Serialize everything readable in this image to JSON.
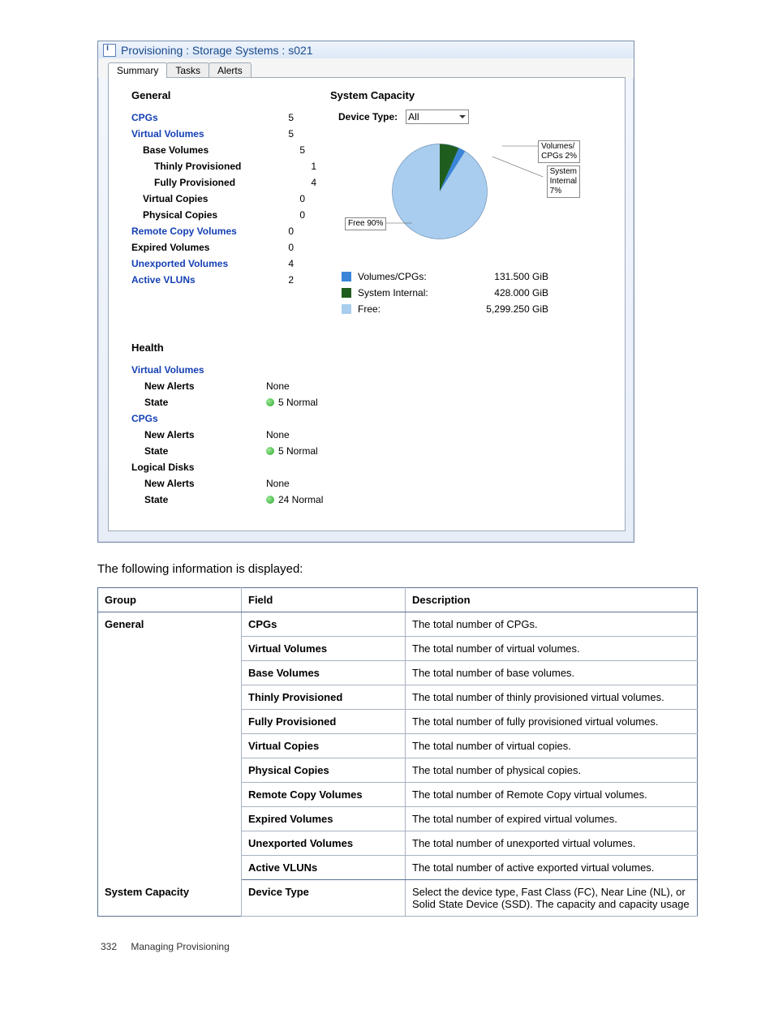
{
  "window": {
    "title": "Provisioning : Storage Systems : s021",
    "tabs": [
      {
        "id": "summary",
        "label": "Summary",
        "active": true
      },
      {
        "id": "tasks",
        "label": "Tasks",
        "active": false
      },
      {
        "id": "alerts",
        "label": "Alerts",
        "active": false
      }
    ]
  },
  "general": {
    "heading": "General",
    "rows": [
      {
        "name": "cpgs",
        "label": "CPGs",
        "value": "5",
        "indent": 0,
        "link": true,
        "bold": true
      },
      {
        "name": "virtual-volumes",
        "label": "Virtual Volumes",
        "value": "5",
        "indent": 0,
        "link": true,
        "bold": true
      },
      {
        "name": "base-volumes",
        "label": "Base Volumes",
        "value": "5",
        "indent": 1,
        "link": false,
        "bold": true
      },
      {
        "name": "thinly-prov",
        "label": "Thinly Provisioned",
        "value": "1",
        "indent": 2,
        "link": false,
        "bold": true
      },
      {
        "name": "fully-prov",
        "label": "Fully Provisioned",
        "value": "4",
        "indent": 2,
        "link": false,
        "bold": true
      },
      {
        "name": "virtual-copies",
        "label": "Virtual Copies",
        "value": "0",
        "indent": 1,
        "link": false,
        "bold": true
      },
      {
        "name": "physical-copies",
        "label": "Physical Copies",
        "value": "0",
        "indent": 1,
        "link": false,
        "bold": true
      },
      {
        "name": "remote-copy-vols",
        "label": "Remote Copy Volumes",
        "value": "0",
        "indent": 0,
        "link": true,
        "bold": true
      },
      {
        "name": "expired-volumes",
        "label": "Expired Volumes",
        "value": "0",
        "indent": 0,
        "link": false,
        "bold": true
      },
      {
        "name": "unexported-volumes",
        "label": "Unexported Volumes",
        "value": "4",
        "indent": 0,
        "link": true,
        "bold": true
      },
      {
        "name": "active-vluns",
        "label": "Active VLUNs",
        "value": "2",
        "indent": 0,
        "link": true,
        "bold": true
      }
    ]
  },
  "capacity": {
    "heading": "System Capacity",
    "device_type_label": "Device Type:",
    "device_type_value": "All",
    "pie_callouts": {
      "volumes_cpgs": "Volumes/\nCPGs 2%",
      "system_internal": "System\nInternal\n7%",
      "free": "Free 90%"
    },
    "legend": [
      {
        "name": "volumes-cpgs",
        "label": "Volumes/CPGs:",
        "value": "131.500 GiB",
        "color": "#3a85d8"
      },
      {
        "name": "system-internal",
        "label": "System Internal:",
        "value": "428.000 GiB",
        "color": "#1f5d1f"
      },
      {
        "name": "free",
        "label": "Free:",
        "value": "5,299.250 GiB",
        "color": "#a8cdee"
      }
    ]
  },
  "chart_data": {
    "type": "pie",
    "title": "System Capacity",
    "series": [
      {
        "name": "Volumes/CPGs",
        "percent": 2,
        "value_gib": 131.5,
        "color": "#3a85d8"
      },
      {
        "name": "System Internal",
        "percent": 7,
        "value_gib": 428.0,
        "color": "#1f5d1f"
      },
      {
        "name": "Free",
        "percent": 90,
        "value_gib": 5299.25,
        "color": "#a8cdee"
      }
    ]
  },
  "health": {
    "heading": "Health",
    "groups": [
      {
        "name": "virtual-volumes",
        "label": "Virtual Volumes",
        "new_alerts_label": "New Alerts",
        "new_alerts": "None",
        "state_label": "State",
        "state": "5 Normal"
      },
      {
        "name": "cpgs",
        "label": "CPGs",
        "new_alerts_label": "New Alerts",
        "new_alerts": "None",
        "state_label": "State",
        "state": "5 Normal"
      },
      {
        "name": "logical-disks",
        "label": "Logical Disks",
        "new_alerts_label": "New Alerts",
        "new_alerts": "None",
        "state_label": "State",
        "state": "24 Normal",
        "nolink": true
      }
    ]
  },
  "doc": {
    "caption": "The following information is displayed:",
    "table_headers": {
      "group": "Group",
      "field": "Field",
      "description": "Description"
    },
    "rows": [
      {
        "group": "General",
        "field": "CPGs",
        "desc": "The total number of CPGs."
      },
      {
        "group": "",
        "field": "Virtual Volumes",
        "desc": "The total number of virtual volumes."
      },
      {
        "group": "",
        "field": "Base Volumes",
        "desc": "The total number of base volumes."
      },
      {
        "group": "",
        "field": "Thinly Provisioned",
        "desc": "The total number of thinly provisioned virtual volumes."
      },
      {
        "group": "",
        "field": "Fully Provisioned",
        "desc": "The total number of fully provisioned virtual volumes."
      },
      {
        "group": "",
        "field": "Virtual Copies",
        "desc": "The total number of virtual copies."
      },
      {
        "group": "",
        "field": "Physical Copies",
        "desc": "The total number of physical copies."
      },
      {
        "group": "",
        "field": "Remote Copy Volumes",
        "desc": "The total number of Remote Copy virtual volumes."
      },
      {
        "group": "",
        "field": "Expired Volumes",
        "desc": "The total number of expired virtual volumes."
      },
      {
        "group": "",
        "field": "Unexported Volumes",
        "desc": "The total number of unexported virtual volumes."
      },
      {
        "group": "",
        "field": "Active VLUNs",
        "desc": "The total number of active exported virtual volumes.",
        "last": true
      },
      {
        "group": "System Capacity",
        "field": "Device Type",
        "desc": "Select the device type, Fast Class (FC), Near Line (NL), or Solid State Device (SSD). The capacity and capacity usage"
      }
    ]
  },
  "footer": {
    "page": "332",
    "section": "Managing Provisioning"
  }
}
